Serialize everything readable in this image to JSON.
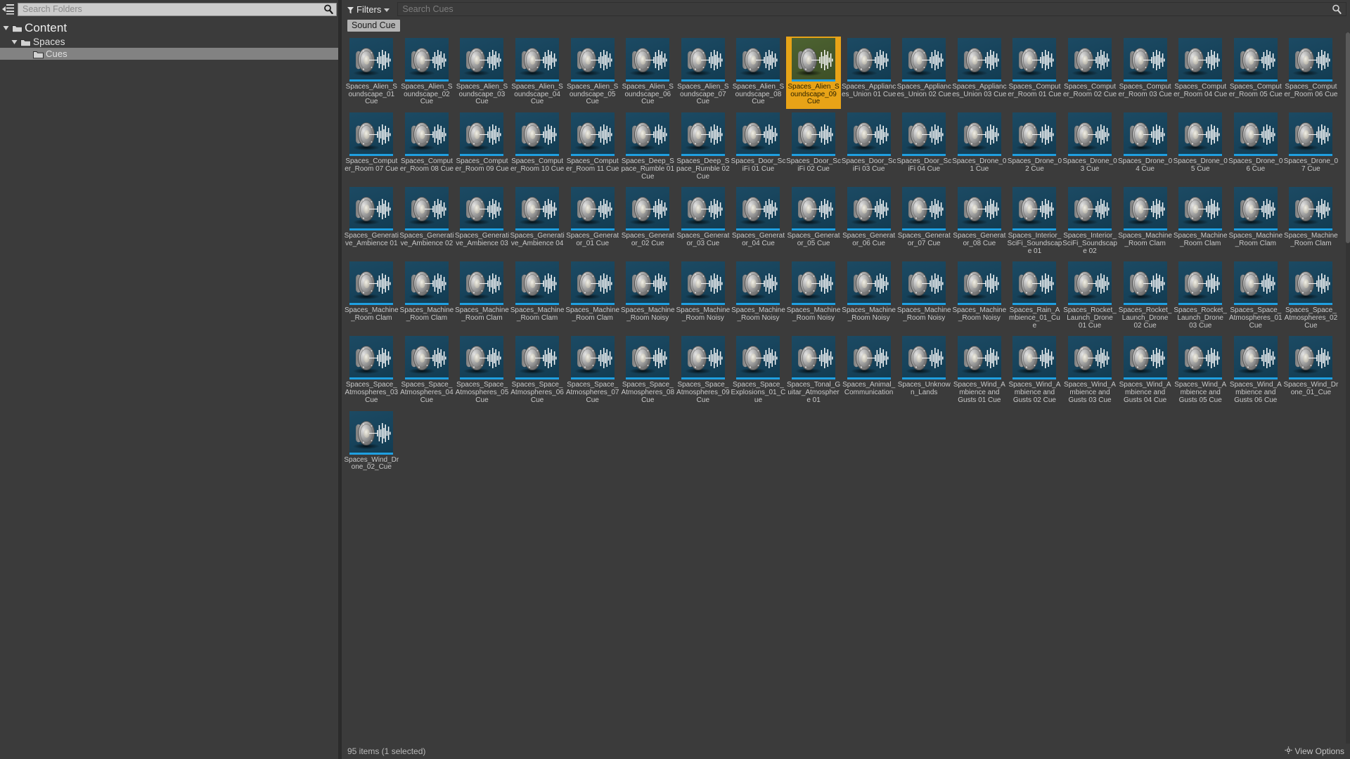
{
  "colors": {
    "app_background": "#3b3b3b",
    "panel_split": "#2b2b2b",
    "selection_amber": "#e8a317",
    "tree_selection": "#828282",
    "thumb_blue": "#17435b",
    "thumb_accent": "#1f9fe0",
    "thumb_selected_green": "#45582c",
    "search_field_light": "#cccccc",
    "filter_chip": "#b4b4b4"
  },
  "folder_panel": {
    "tree_toggle_icon": "tree-collapse-icon",
    "search": {
      "placeholder": "Search Folders",
      "value": "",
      "icon": "search-icon"
    },
    "tree": [
      {
        "label": "Content",
        "depth": 0,
        "expanded": true,
        "selected": false,
        "icon": "folder-icon"
      },
      {
        "label": "Spaces",
        "depth": 1,
        "expanded": true,
        "selected": false,
        "icon": "folder-icon"
      },
      {
        "label": "Cues",
        "depth": 2,
        "expanded": false,
        "selected": true,
        "icon": "folder-icon"
      }
    ]
  },
  "asset_panel": {
    "toolbar": {
      "filters_label": "Filters",
      "filters_icon": "funnel-icon",
      "filters_caret_icon": "chevron-down-icon",
      "search": {
        "placeholder": "Search Cues",
        "value": "",
        "icon": "search-icon"
      }
    },
    "active_filters": [
      {
        "label": "Sound Cue"
      }
    ],
    "status": {
      "left_text": "95 items (1 selected)",
      "view_options_label": "View Options",
      "view_options_icon": "gear-icon"
    },
    "selected_asset": "Spaces_Alien_Soundscape_09_Cue",
    "assets": [
      {
        "label": "Spaces_Alien_Soundscape_01 Cue",
        "selected": false
      },
      {
        "label": "Spaces_Alien_Soundscape_02 Cue",
        "selected": false
      },
      {
        "label": "Spaces_Alien_Soundscape_03 Cue",
        "selected": false
      },
      {
        "label": "Spaces_Alien_Soundscape_04 Cue",
        "selected": false
      },
      {
        "label": "Spaces_Alien_Soundscape_05 Cue",
        "selected": false
      },
      {
        "label": "Spaces_Alien_Soundscape_06 Cue",
        "selected": false
      },
      {
        "label": "Spaces_Alien_Soundscape_07 Cue",
        "selected": false
      },
      {
        "label": "Spaces_Alien_Soundscape_08 Cue",
        "selected": false
      },
      {
        "label": "Spaces_Alien_Soundscape_09 Cue",
        "selected": true
      },
      {
        "label": "Spaces_Appliances_Union 01 Cue",
        "selected": false
      },
      {
        "label": "Spaces_Appliances_Union 02 Cue",
        "selected": false
      },
      {
        "label": "Spaces_Appliances_Union 03 Cue",
        "selected": false
      },
      {
        "label": "Spaces_Computer_Room 01 Cue",
        "selected": false
      },
      {
        "label": "Spaces_Computer_Room 02 Cue",
        "selected": false
      },
      {
        "label": "Spaces_Computer_Room 03 Cue",
        "selected": false
      },
      {
        "label": "Spaces_Computer_Room 04 Cue",
        "selected": false
      },
      {
        "label": "Spaces_Computer_Room 05 Cue",
        "selected": false
      },
      {
        "label": "Spaces_Computer_Room 06 Cue",
        "selected": false
      },
      {
        "label": "Spaces_Computer_Room 07 Cue",
        "selected": false
      },
      {
        "label": "Spaces_Computer_Room 08 Cue",
        "selected": false
      },
      {
        "label": "Spaces_Computer_Room 09 Cue",
        "selected": false
      },
      {
        "label": "Spaces_Computer_Room 10 Cue",
        "selected": false
      },
      {
        "label": "Spaces_Computer_Room 11 Cue",
        "selected": false
      },
      {
        "label": "Spaces_Deep_Space_Rumble 01 Cue",
        "selected": false
      },
      {
        "label": "Spaces_Deep_Space_Rumble 02 Cue",
        "selected": false
      },
      {
        "label": "Spaces_Door_SciFi 01 Cue",
        "selected": false
      },
      {
        "label": "Spaces_Door_SciFi 02 Cue",
        "selected": false
      },
      {
        "label": "Spaces_Door_SciFi 03 Cue",
        "selected": false
      },
      {
        "label": "Spaces_Door_SciFi 04 Cue",
        "selected": false
      },
      {
        "label": "Spaces_Drone_01 Cue",
        "selected": false
      },
      {
        "label": "Spaces_Drone_02 Cue",
        "selected": false
      },
      {
        "label": "Spaces_Drone_03 Cue",
        "selected": false
      },
      {
        "label": "Spaces_Drone_04 Cue",
        "selected": false
      },
      {
        "label": "Spaces_Drone_05 Cue",
        "selected": false
      },
      {
        "label": "Spaces_Drone_06 Cue",
        "selected": false
      },
      {
        "label": "Spaces_Drone_07 Cue",
        "selected": false
      },
      {
        "label": "Spaces_Generative_Ambience 01",
        "selected": false
      },
      {
        "label": "Spaces_Generative_Ambience 02",
        "selected": false
      },
      {
        "label": "Spaces_Generative_Ambience 03",
        "selected": false
      },
      {
        "label": "Spaces_Generative_Ambience 04",
        "selected": false
      },
      {
        "label": "Spaces_Generator_01 Cue",
        "selected": false
      },
      {
        "label": "Spaces_Generator_02 Cue",
        "selected": false
      },
      {
        "label": "Spaces_Generator_03 Cue",
        "selected": false
      },
      {
        "label": "Spaces_Generator_04 Cue",
        "selected": false
      },
      {
        "label": "Spaces_Generator_05 Cue",
        "selected": false
      },
      {
        "label": "Spaces_Generator_06 Cue",
        "selected": false
      },
      {
        "label": "Spaces_Generator_07 Cue",
        "selected": false
      },
      {
        "label": "Spaces_Generator_08 Cue",
        "selected": false
      },
      {
        "label": "Spaces_Interior_SciFi_Soundscape 01",
        "selected": false
      },
      {
        "label": "Spaces_Interior_SciFi_Soundscape 02",
        "selected": false
      },
      {
        "label": "Spaces_Machine_Room Clam",
        "selected": false
      },
      {
        "label": "Spaces_Machine_Room Clam",
        "selected": false
      },
      {
        "label": "Spaces_Machine_Room Clam",
        "selected": false
      },
      {
        "label": "Spaces_Machine_Room Clam",
        "selected": false
      },
      {
        "label": "Spaces_Machine_Room Clam",
        "selected": false
      },
      {
        "label": "Spaces_Machine_Room Clam",
        "selected": false
      },
      {
        "label": "Spaces_Machine_Room Clam",
        "selected": false
      },
      {
        "label": "Spaces_Machine_Room Clam",
        "selected": false
      },
      {
        "label": "Spaces_Machine_Room Clam",
        "selected": false
      },
      {
        "label": "Spaces_Machine_Room Noisy",
        "selected": false
      },
      {
        "label": "Spaces_Machine_Room Noisy",
        "selected": false
      },
      {
        "label": "Spaces_Machine_Room Noisy",
        "selected": false
      },
      {
        "label": "Spaces_Machine_Room Noisy",
        "selected": false
      },
      {
        "label": "Spaces_Machine_Room Noisy",
        "selected": false
      },
      {
        "label": "Spaces_Machine_Room Noisy",
        "selected": false
      },
      {
        "label": "Spaces_Machine_Room Noisy",
        "selected": false
      },
      {
        "label": "Spaces_Rain_Ambience_01_Cue",
        "selected": false
      },
      {
        "label": "Spaces_Rocket_Launch_Drone 01 Cue",
        "selected": false
      },
      {
        "label": "Spaces_Rocket_Launch_Drone 02 Cue",
        "selected": false
      },
      {
        "label": "Spaces_Rocket_Launch_Drone 03 Cue",
        "selected": false
      },
      {
        "label": "Spaces_Space_Atmospheres_01 Cue",
        "selected": false
      },
      {
        "label": "Spaces_Space_Atmospheres_02 Cue",
        "selected": false
      },
      {
        "label": "Spaces_Space_Atmospheres_03 Cue",
        "selected": false
      },
      {
        "label": "Spaces_Space_Atmospheres_04 Cue",
        "selected": false
      },
      {
        "label": "Spaces_Space_Atmospheres_05 Cue",
        "selected": false
      },
      {
        "label": "Spaces_Space_Atmospheres_06 Cue",
        "selected": false
      },
      {
        "label": "Spaces_Space_Atmospheres_07 Cue",
        "selected": false
      },
      {
        "label": "Spaces_Space_Atmospheres_08 Cue",
        "selected": false
      },
      {
        "label": "Spaces_Space_Atmospheres_09 Cue",
        "selected": false
      },
      {
        "label": "Spaces_Space_Explosions_01_Cue",
        "selected": false
      },
      {
        "label": "Spaces_Tonal_Guitar_Atmosphere 01",
        "selected": false
      },
      {
        "label": "Spaces_Animal_Communication",
        "selected": false
      },
      {
        "label": "Spaces_Unknown_Lands",
        "selected": false
      },
      {
        "label": "Spaces_Wind_Ambience and Gusts 01 Cue",
        "selected": false
      },
      {
        "label": "Spaces_Wind_Ambience and Gusts 02 Cue",
        "selected": false
      },
      {
        "label": "Spaces_Wind_Ambience and Gusts 03 Cue",
        "selected": false
      },
      {
        "label": "Spaces_Wind_Ambience and Gusts 04 Cue",
        "selected": false
      },
      {
        "label": "Spaces_Wind_Ambience and Gusts 05 Cue",
        "selected": false
      },
      {
        "label": "Spaces_Wind_Ambience and Gusts 06 Cue",
        "selected": false
      },
      {
        "label": "Spaces_Wind_Drone_01_Cue",
        "selected": false
      },
      {
        "label": "Spaces_Wind_Drone_02_Cue",
        "selected": false
      }
    ]
  }
}
